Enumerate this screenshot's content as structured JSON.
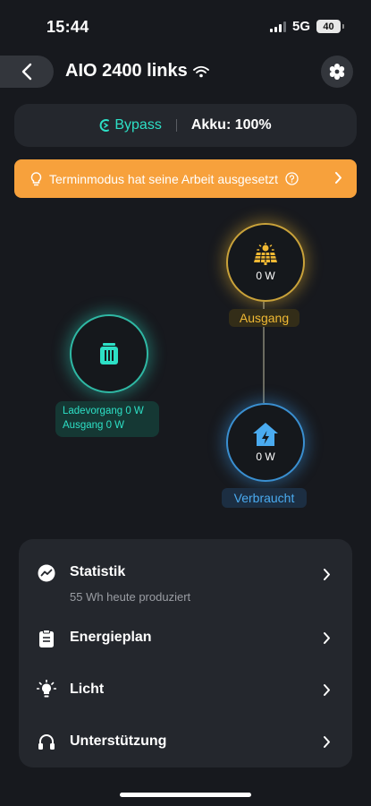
{
  "status_bar": {
    "time": "15:44",
    "network": "5G",
    "battery": "40"
  },
  "header": {
    "title": "AIO 2400 links",
    "back_icon": "chevron-left-icon",
    "settings_icon": "gear-icon"
  },
  "mode": {
    "bypass_label": "Bypass",
    "akku_label": "Akku: 100%",
    "bypass_color": "#2de0c6"
  },
  "warning": {
    "text": "Terminmodus hat seine Arbeit ausgesetzt",
    "color": "#f7a13c"
  },
  "flow": {
    "solar": {
      "value": "0 W",
      "tag": "Ausgang",
      "color": "#f0b934"
    },
    "home": {
      "value": "0 W",
      "tag": "Verbraucht",
      "color": "#4aabf0"
    },
    "battery": {
      "charging": "Ladevorgang 0 W",
      "output": "Ausgang 0 W",
      "color": "#2de0c6"
    }
  },
  "menu": {
    "items": [
      {
        "label": "Statistik",
        "sub": "55 Wh heute produziert",
        "icon": "chart-line-icon"
      },
      {
        "label": "Energieplan",
        "icon": "clipboard-icon"
      },
      {
        "label": "Licht",
        "icon": "lightbulb-icon"
      },
      {
        "label": "Unterstützung",
        "icon": "headset-icon"
      }
    ]
  }
}
